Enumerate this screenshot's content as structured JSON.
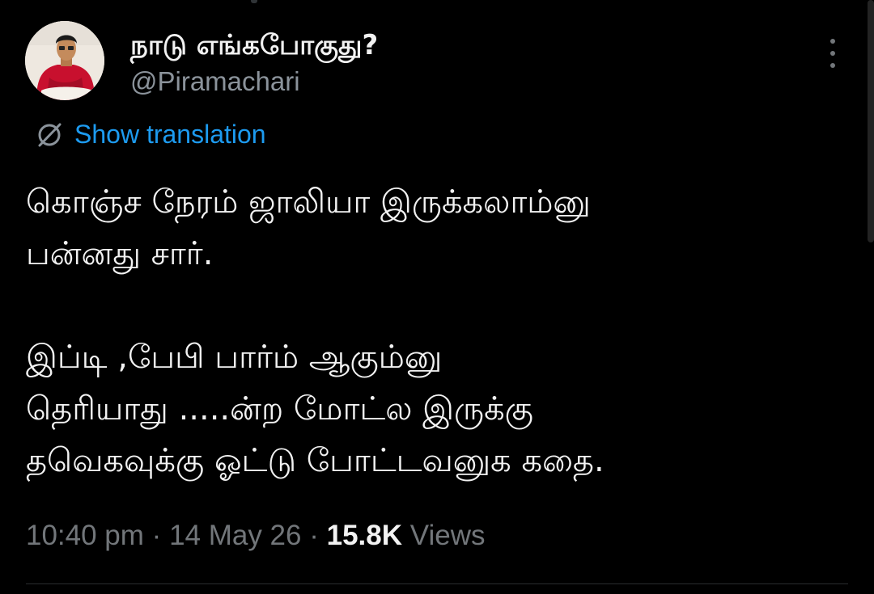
{
  "tweet": {
    "display_name": "நாடு எங்கபோகுது?",
    "handle": "@Piramachari",
    "translate_label": "Show translation",
    "text_lines": [
      "கொஞ்ச நேரம் ஜாலியா இருக்கலாம்னு",
      "பன்னது சார்.",
      "",
      "இப்டி ,பேபி பார்ம் ஆகும்னு",
      "தெரியாது .....ன்ற மோட்ல இருக்கு",
      "தவெகவுக்கு ஓட்டு போட்டவனுக கதை."
    ],
    "time": "10:40 pm",
    "date": "14 May 26",
    "views_count": "15.8K",
    "views_label": "Views",
    "separator": "·"
  },
  "colors": {
    "background": "#000000",
    "text": "#e7e9ea",
    "secondary": "#72767a",
    "link": "#1d9bf0"
  },
  "icons": {
    "avatar": "profile-photo",
    "translate": "translate-icon",
    "more": "more-vertical-icon"
  }
}
